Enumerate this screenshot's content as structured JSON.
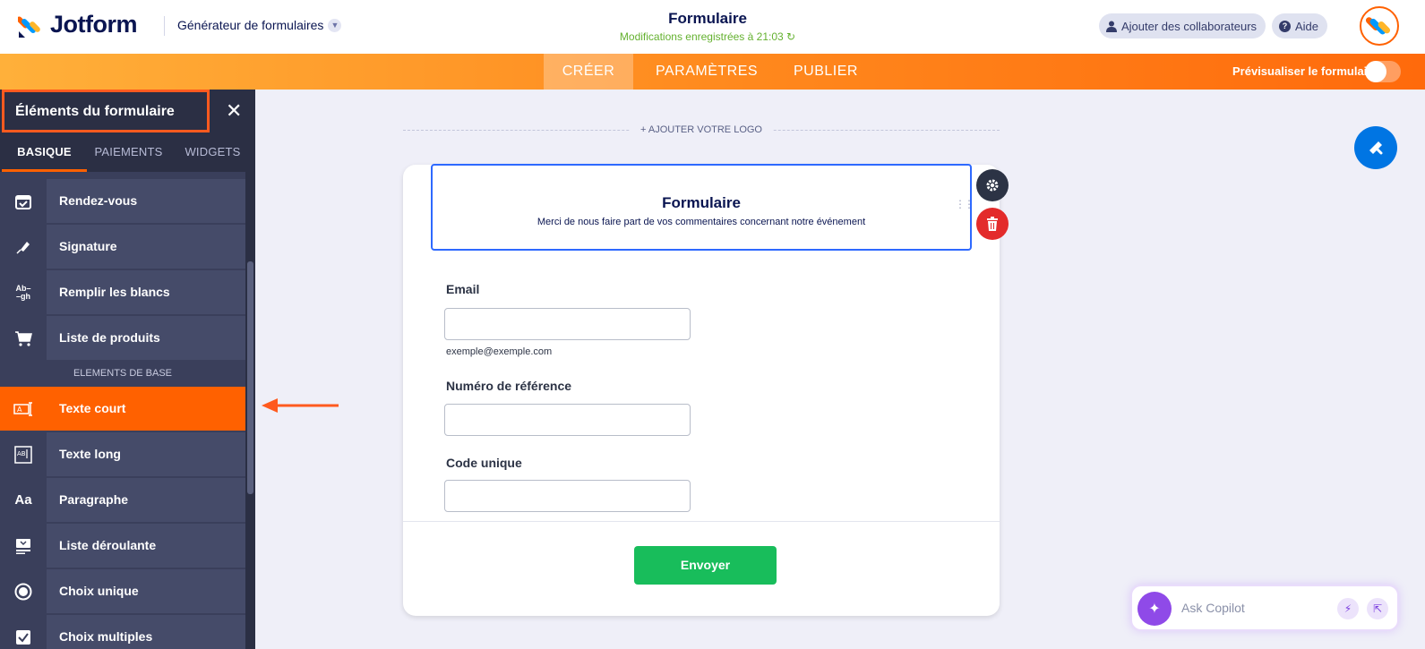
{
  "app": {
    "brand": "Jotform",
    "builder_label": "Générateur de formulaires",
    "form_title": "Formulaire",
    "save_status": "Modifications enregistrées à 21:03",
    "add_collaborators": "Ajouter des collaborateurs",
    "help": "Aide"
  },
  "nav": {
    "tabs": [
      "CRÉER",
      "PARAMÈTRES",
      "PUBLIER"
    ],
    "active_tab": "CRÉER",
    "preview_label": "Prévisualiser le formulaire",
    "preview_enabled": false
  },
  "sidebar": {
    "title": "Éléments du formulaire",
    "tabs": [
      "BASIQUE",
      "PAIEMENTS",
      "WIDGETS"
    ],
    "active_tab": "BASIQUE",
    "items_top": [
      {
        "label": "Rendez-vous",
        "icon": "calendar-check-icon"
      },
      {
        "label": "Signature",
        "icon": "pen-signature-icon"
      },
      {
        "label": "Remplir les blancs",
        "icon": "fill-blanks-icon"
      },
      {
        "label": "Liste de produits",
        "icon": "cart-icon"
      }
    ],
    "section_label": "ELEMENTS DE BASE",
    "items_basic": [
      {
        "label": "Texte court",
        "icon": "short-text-icon",
        "active": true
      },
      {
        "label": "Texte long",
        "icon": "long-text-icon"
      },
      {
        "label": "Paragraphe",
        "icon": "paragraph-icon"
      },
      {
        "label": "Liste déroulante",
        "icon": "dropdown-icon"
      },
      {
        "label": "Choix unique",
        "icon": "radio-icon"
      },
      {
        "label": "Choix multiples",
        "icon": "checkbox-icon"
      }
    ]
  },
  "form": {
    "add_logo": "+ AJOUTER VOTRE LOGO",
    "heading": "Formulaire",
    "subheading": "Merci de nous faire part de vos commentaires concernant notre événement",
    "fields": [
      {
        "label": "Email",
        "value": "",
        "hint": "exemple@exemple.com"
      },
      {
        "label": "Numéro de référence",
        "value": ""
      },
      {
        "label": "Code unique",
        "value": ""
      }
    ],
    "submit_label": "Envoyer"
  },
  "copilot": {
    "placeholder": "Ask Copilot"
  },
  "colors": {
    "accent": "#ff6100",
    "focus": "#2e69ff",
    "submit": "#18bd5b",
    "sidebar": "#3a3f5b"
  }
}
